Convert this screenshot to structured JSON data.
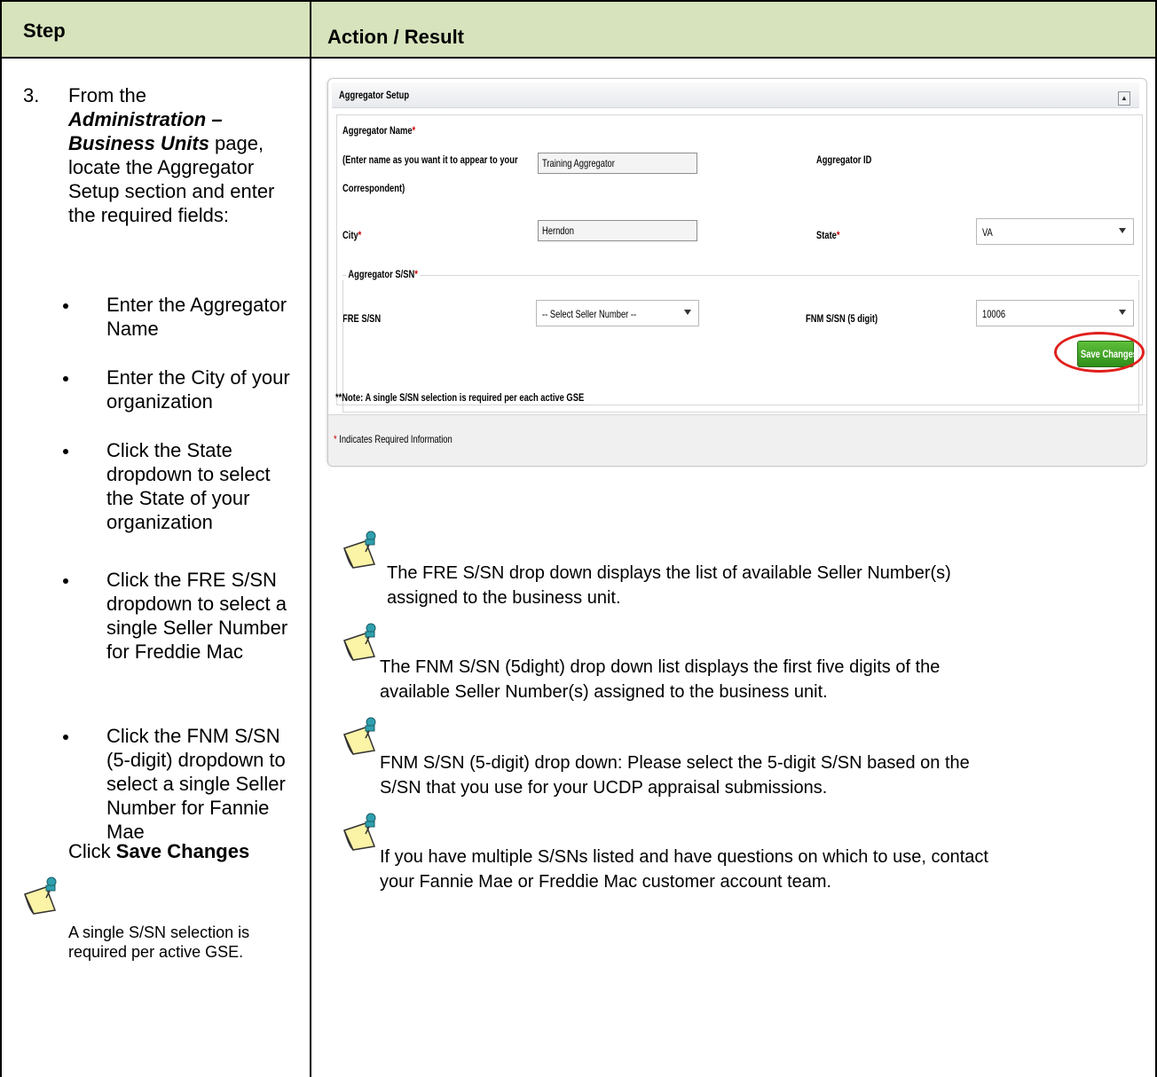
{
  "table": {
    "header_step": "Step",
    "header_action": "Action / Result"
  },
  "step": {
    "number": "3.",
    "intro_1": "From the",
    "intro_italic": "Administration – Business Units",
    "intro_2": " page, locate the Aggregator Setup section and enter the required fields:",
    "bullets": [
      "Enter the Aggregator Name",
      "Enter the City of your organization",
      "Click the State dropdown to select the State of your organization",
      "Click the FRE S/SN dropdown to select a single Seller Number for Freddie Mac",
      "Click the FNM S/SN (5-digit) dropdown to select a single Seller Number for Fannie Mae"
    ],
    "click_prefix": "Click ",
    "click_bold": "Save Changes",
    "note": "A single S/SN selection is required per active GSE."
  },
  "panel": {
    "title": "Aggregator Setup",
    "name_label": "Aggregator Name",
    "name_hint_1": "(Enter name as you want it to appear to your",
    "name_hint_2": "Correspondent)",
    "name_value": "Training Aggregator",
    "id_label": "Aggregator ID",
    "city_label": "City",
    "city_value": "Herndon",
    "state_label": "State",
    "state_value": "VA",
    "ssn_legend": "Aggregator S/SN",
    "fre_label": "FRE S/SN",
    "fre_value": "-- Select Seller Number --",
    "fnm_label": "FNM S/SN (5 digit)",
    "fnm_value": "10006",
    "save_label": "Save Changes",
    "note": "**Note: A single S/SN selection is required per each active GSE",
    "required_note": "Indicates Required Information",
    "required_star": "*"
  },
  "notes": [
    {
      "line1": "The FRE S/SN drop down displays  the list of available Seller Number(s)",
      "line2": "assigned to the business unit."
    },
    {
      "line1": "The FNM S/SN (5dight)  drop down list displays the first five digits of the",
      "line2": "available Seller Number(s) assigned to the business unit."
    },
    {
      "line1": " FNM S/SN (5-digit) drop down: Please select the 5-digit S/SN based on the",
      "line2": "S/SN that you use for your UCDP appraisal submissions."
    },
    {
      "line1": "If you have multiple S/SNs listed and have questions on which to use, contact",
      "line2": "your Fannie Mae or Freddie Mac customer account team."
    }
  ],
  "colors": {
    "header_bg": "#d7e3bc",
    "required": "#cc0000",
    "save_button": "#3a9a22",
    "highlight_oval": "#e0201c"
  },
  "icons": [
    "note-pin-icon",
    "chevron-up-icon",
    "dropdown-caret-icon"
  ]
}
